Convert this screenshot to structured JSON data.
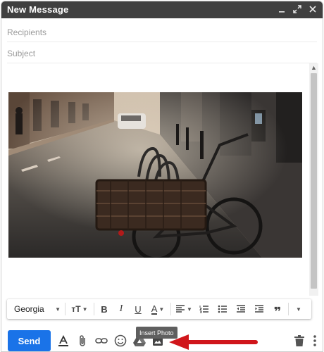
{
  "window": {
    "title": "New Message",
    "controls": [
      "minimize-icon",
      "expand-icon",
      "close-icon"
    ]
  },
  "recipients": {
    "placeholder": "Recipients"
  },
  "subject": {
    "placeholder": "Subject"
  },
  "formatting_toolbar": {
    "font": "Georgia",
    "items": [
      "font-size-icon",
      "bold-icon",
      "italic-icon",
      "underline-icon",
      "text-color-icon",
      "align-icon",
      "numbered-list-icon",
      "bulleted-list-icon",
      "indent-less-icon",
      "indent-more-icon",
      "quote-icon",
      "more-formatting-icon"
    ]
  },
  "bottom_toolbar": {
    "send_label": "Send",
    "tooltip": "Insert Photo",
    "icons": [
      "formatting-options-icon",
      "attach-icon",
      "link-icon",
      "emoji-icon",
      "drive-icon",
      "photo-icon",
      "trash-icon",
      "more-options-icon"
    ]
  },
  "colors": {
    "titlebar": "#404040",
    "send_button": "#1a73e8",
    "annotation_arrow": "#d0161b"
  }
}
